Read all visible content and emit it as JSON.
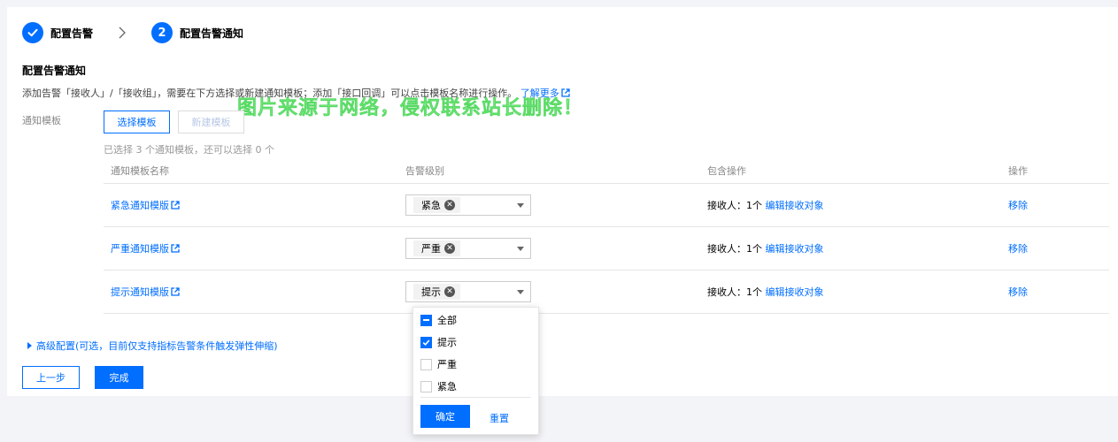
{
  "steps": [
    {
      "label": "配置告警",
      "state": "done"
    },
    {
      "number": "2",
      "label": "配置告警通知",
      "state": "active"
    }
  ],
  "section": {
    "title": "配置告警通知",
    "description": "添加告警「接收人」/「接收组」，需要在下方选择或新建通知模板；添加「接口回调」可以点击模板名称进行操作。",
    "learn_more": "了解更多"
  },
  "watermark": "图片来源于网络，侵权联系站长删除！",
  "template_field": {
    "label": "通知模板",
    "select_button": "选择模板",
    "new_button": "新建模板",
    "hint": "已选择 3 个通知模板，还可以选择 0 个"
  },
  "table": {
    "headers": [
      "通知模板名称",
      "告警级别",
      "包含操作",
      "操作"
    ],
    "rows": [
      {
        "name": "紧急通知模版",
        "level": "紧急",
        "receivers": "接收人：1个",
        "edit": "编辑接收对象",
        "action": "移除"
      },
      {
        "name": "严重通知模版",
        "level": "严重",
        "receivers": "接收人：1个",
        "edit": "编辑接收对象",
        "action": "移除"
      },
      {
        "name": "提示通知模版",
        "level": "提示",
        "receivers": "接收人：1个",
        "edit": "编辑接收对象",
        "action": "移除"
      }
    ]
  },
  "advanced": "高级配置(可选，目前仅支持指标告警条件触发弹性伸缩)",
  "buttons": {
    "prev": "上一步",
    "finish": "完成"
  },
  "dropdown": {
    "options": [
      {
        "label": "全部",
        "state": "partial"
      },
      {
        "label": "提示",
        "state": "checked"
      },
      {
        "label": "严重",
        "state": "unchecked"
      },
      {
        "label": "紧急",
        "state": "unchecked"
      }
    ],
    "confirm": "确定",
    "reset": "重置"
  },
  "colors": {
    "accent": "#006eff",
    "background": "#f3f4f7"
  }
}
